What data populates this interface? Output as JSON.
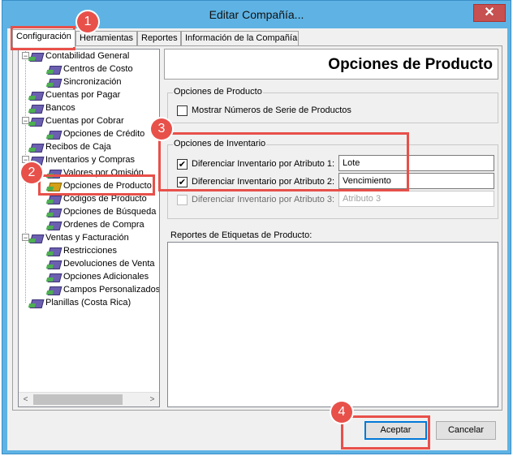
{
  "window": {
    "title": "Editar Compañía...",
    "close_label": "✕"
  },
  "tabs": [
    {
      "label": "Configuración",
      "active": true
    },
    {
      "label": "Herramientas"
    },
    {
      "label": "Reportes"
    },
    {
      "label": "Información de la Compañía"
    }
  ],
  "tree": {
    "items": [
      {
        "label": "Contabilidad General",
        "level": 0,
        "expanded": true
      },
      {
        "label": "Centros de Costo",
        "level": 1
      },
      {
        "label": "Sincronización",
        "level": 1
      },
      {
        "label": "Cuentas por Pagar",
        "level": 0
      },
      {
        "label": "Bancos",
        "level": 0
      },
      {
        "label": "Cuentas por Cobrar",
        "level": 0,
        "expanded": true
      },
      {
        "label": "Opciones de Crédito",
        "level": 1
      },
      {
        "label": "Recibos de Caja",
        "level": 0
      },
      {
        "label": "Inventarios y Compras",
        "level": 0,
        "expanded": true
      },
      {
        "label": "Valores por Omisión",
        "level": 1
      },
      {
        "label": "Opciones de Producto",
        "level": 1,
        "selected": true
      },
      {
        "label": "Códigos de Producto",
        "level": 1
      },
      {
        "label": "Opciones de Búsqueda",
        "level": 1
      },
      {
        "label": "Ordenes de Compra",
        "level": 1
      },
      {
        "label": "Ventas y Facturación",
        "level": 0,
        "expanded": true
      },
      {
        "label": "Restricciones",
        "level": 1
      },
      {
        "label": "Devoluciones de Venta",
        "level": 1
      },
      {
        "label": "Opciones Adicionales",
        "level": 1
      },
      {
        "label": "Campos Personalizados",
        "level": 1
      },
      {
        "label": "Planillas (Costa Rica)",
        "level": 0
      }
    ]
  },
  "panel": {
    "title": "Opciones de Producto",
    "product_group": {
      "label": "Opciones de Producto",
      "show_serials_label": "Mostrar Números de Serie de Productos",
      "show_serials_checked": false
    },
    "inventory_group": {
      "label": "Opciones de Inventario",
      "attr1_label": "Diferenciar Inventario por Atributo 1:",
      "attr1_checked": true,
      "attr1_value": "Lote",
      "attr2_label": "Diferenciar Inventario por Atributo 2:",
      "attr2_checked": true,
      "attr2_value": "Vencimiento",
      "attr3_label": "Diferenciar Inventario por Atributo 3:",
      "attr3_checked": false,
      "attr3_value": "Atributo 3"
    },
    "labels_report_label": "Reportes de Etiquetas de Producto:"
  },
  "buttons": {
    "accept": "Aceptar",
    "cancel": "Cancelar"
  },
  "scroll": {
    "left_arrow": "<",
    "right_arrow": ">"
  },
  "annotations": [
    "1",
    "2",
    "3",
    "4"
  ],
  "colors": {
    "annotation": "#e8504a",
    "titlebar": "#5eb3e4"
  }
}
